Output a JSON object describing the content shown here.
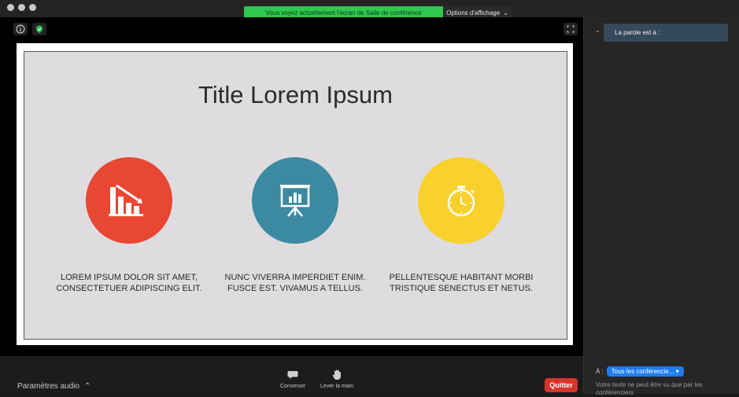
{
  "header": {
    "share_banner": "Vous voyez actuellement l'écran de Salle de conférence",
    "view_options": "Options d'affichage"
  },
  "slide": {
    "title": "Title Lorem Ipsum",
    "items": [
      {
        "icon": "bar-chart-icon",
        "color": "#e84733",
        "caption_line1": "LOREM IPSUM DOLOR SIT AMET,",
        "caption_line2": "CONSECTETUER ADIPISCING ELIT."
      },
      {
        "icon": "presentation-board-icon",
        "color": "#3c8aa1",
        "caption_line1": "NUNC VIVERRA IMPERDIET ENIM.",
        "caption_line2": "FUSCE EST. VIVAMUS A TELLUS."
      },
      {
        "icon": "stopwatch-icon",
        "color": "#f8d12c",
        "caption_line1": "PELLENTESQUE HABITANT MORBI",
        "caption_line2": "TRISTIQUE SENECTUS ET NETUS."
      }
    ]
  },
  "sidebar": {
    "spotlight_label": "La parole est à :",
    "to_label": "À :",
    "to_selected": "Tous les conférencie...",
    "hint": "Votre texte ne peut être vu que par les conférenciers"
  },
  "toolbar": {
    "audio_label": "Paramètres audio",
    "chat_label": "Converser",
    "raise_hand_label": "Lever la main",
    "quit_label": "Quitter"
  },
  "colors": {
    "accent_green": "#2fc74f",
    "quit_red": "#d6342a",
    "badge_blue": "#1e7cf2"
  }
}
